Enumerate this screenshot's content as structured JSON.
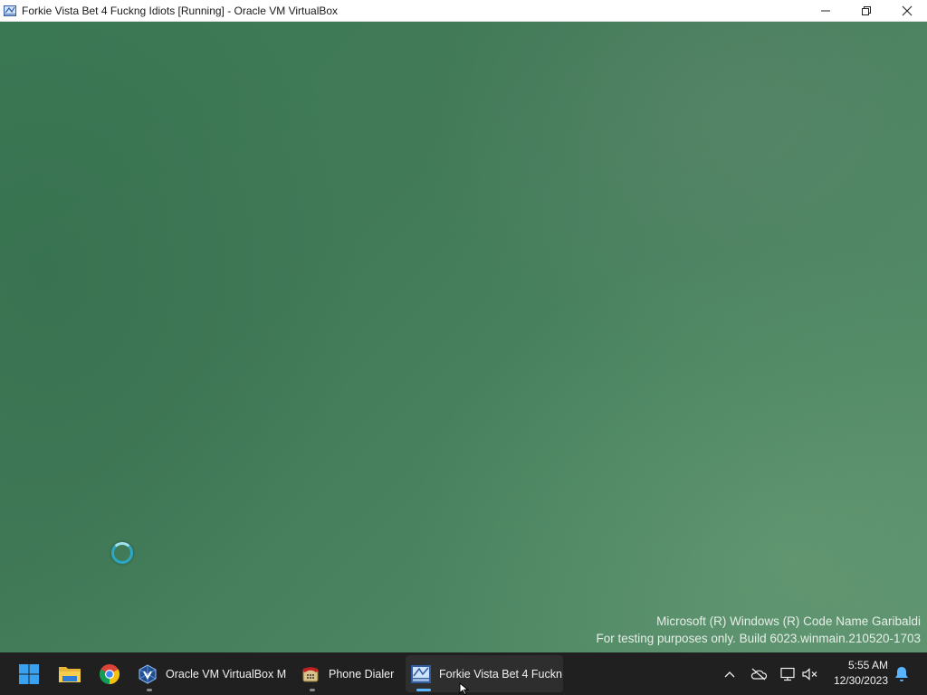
{
  "window": {
    "title": "Forkie Vista Bet 4 Fuckng Idiots [Running] - Oracle VM VirtualBox",
    "controls": {
      "minimize": "minimize-icon",
      "maximize": "maximize-icon",
      "close": "close-icon"
    }
  },
  "vm_screen": {
    "background_color": "#457f5a",
    "spinner_color": "#2aa8c6",
    "watermark_line1": "Microsoft (R) Windows (R) Code Name Garibaldi",
    "watermark_line2": "For testing purposes only. Build 6023.winmain.210520-1703"
  },
  "taskbar": {
    "background_color": "#202020",
    "pinned": [
      {
        "name": "start",
        "icon": "windows-start-icon"
      },
      {
        "name": "file-explorer",
        "icon": "folder-icon"
      },
      {
        "name": "chrome",
        "icon": "chrome-icon"
      }
    ],
    "apps": [
      {
        "label": "Oracle VM VirtualBox M",
        "icon": "virtualbox-icon",
        "active": false
      },
      {
        "label": "Phone Dialer",
        "icon": "phone-dialer-icon",
        "active": false
      },
      {
        "label": "Forkie Vista Bet 4 Fuckn",
        "icon": "vm-window-icon",
        "active": true
      }
    ],
    "tray": {
      "icons": [
        "chevron-up-icon",
        "onedrive-offline-icon",
        "network-icon",
        "volume-muted-icon",
        "notification-bell-icon"
      ],
      "time": "5:55 AM",
      "date": "12/30/2023"
    }
  }
}
